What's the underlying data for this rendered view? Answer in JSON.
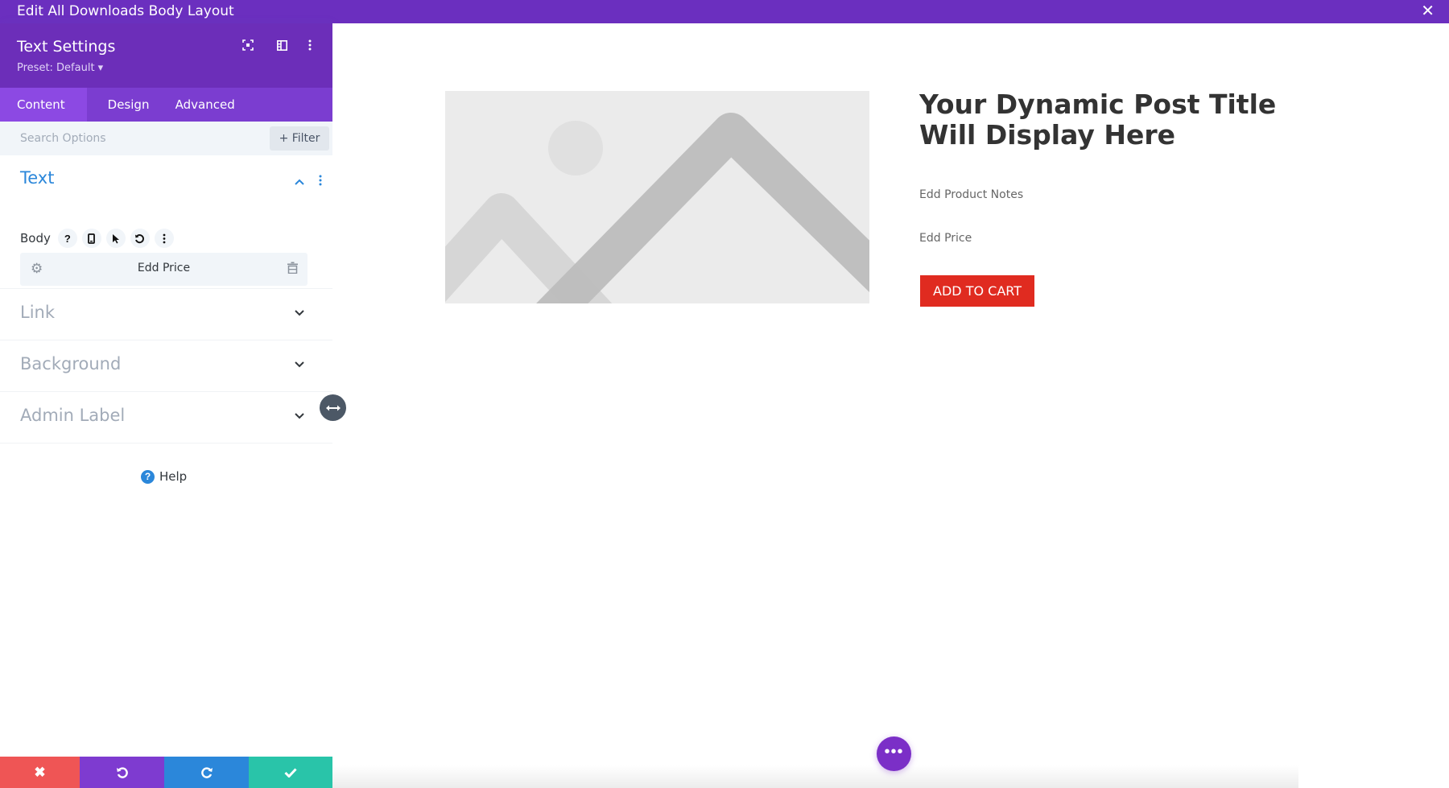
{
  "window": {
    "title": "Edit All Downloads Body Layout",
    "close_icon": "close-icon"
  },
  "panel": {
    "title": "Text Settings",
    "preset": "Preset: Default ▾",
    "header_icons": [
      "focus-icon",
      "split-view-icon",
      "more-options-icon"
    ],
    "tabs": [
      {
        "label": "Content",
        "active": true
      },
      {
        "label": "Design",
        "active": false
      },
      {
        "label": "Advanced",
        "active": false
      }
    ],
    "search": {
      "placeholder": "Search Options",
      "value": ""
    },
    "filter_label": "+ Filter",
    "open_section": {
      "title": "Text",
      "field_label": "Body",
      "field_icons": [
        "help-icon",
        "responsive-icon",
        "hover-icon",
        "reset-icon",
        "more-options-icon"
      ],
      "dynamic_value": "Edd Price"
    },
    "collapsed_sections": [
      {
        "title": "Link"
      },
      {
        "title": "Background"
      },
      {
        "title": "Admin Label"
      }
    ],
    "help_label": "Help",
    "bottom_buttons": [
      {
        "name": "discard",
        "icon": "close-icon",
        "color": "#ef5555"
      },
      {
        "name": "undo",
        "icon": "undo-icon",
        "color": "#7e3bd0"
      },
      {
        "name": "redo",
        "icon": "redo-icon",
        "color": "#2b87da"
      },
      {
        "name": "save",
        "icon": "check-icon",
        "color": "#29c4a9"
      }
    ]
  },
  "canvas": {
    "image_placeholder": "image-placeholder",
    "post_title": "Your Dynamic Post Title Will Display Here",
    "product_notes": "Edd Product Notes",
    "price": "Edd Price",
    "cart_button": "ADD TO CART",
    "cart_color": "#e02b20",
    "more_button": "•••"
  },
  "colors": {
    "accent": "#6c2eb9",
    "link": "#2b87da"
  }
}
